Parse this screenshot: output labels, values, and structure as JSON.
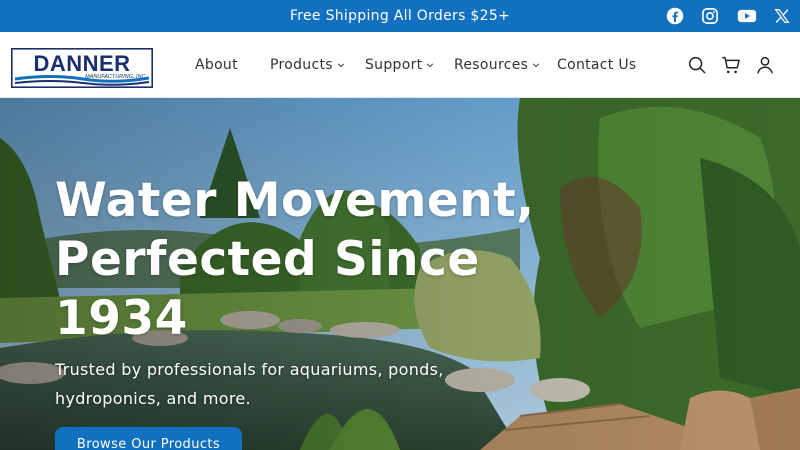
{
  "announcement": {
    "text": "Free Shipping All Orders $25+"
  },
  "social": [
    {
      "icon": "facebook-icon"
    },
    {
      "icon": "instagram-icon"
    },
    {
      "icon": "youtube-icon"
    },
    {
      "icon": "x-icon"
    }
  ],
  "logo": {
    "name": "DANNER",
    "sub": "MANUFACTURING, INC."
  },
  "nav": {
    "about": "About",
    "products": "Products",
    "support": "Support",
    "resources": "Resources",
    "contact": "Contact Us"
  },
  "header_icons": [
    "search-icon",
    "cart-icon",
    "account-icon"
  ],
  "hero": {
    "title_line1": "Water Movement,",
    "title_line2": "Perfected Since",
    "title_line3": "1934",
    "subtitle_line1": "Trusted by professionals for aquariums, ponds,",
    "subtitle_line2": "hydroponics, and more.",
    "button_label": "Browse Our Products"
  },
  "colors": {
    "brand_blue": "#1170c0",
    "logo_navy": "#1a2f6e"
  }
}
